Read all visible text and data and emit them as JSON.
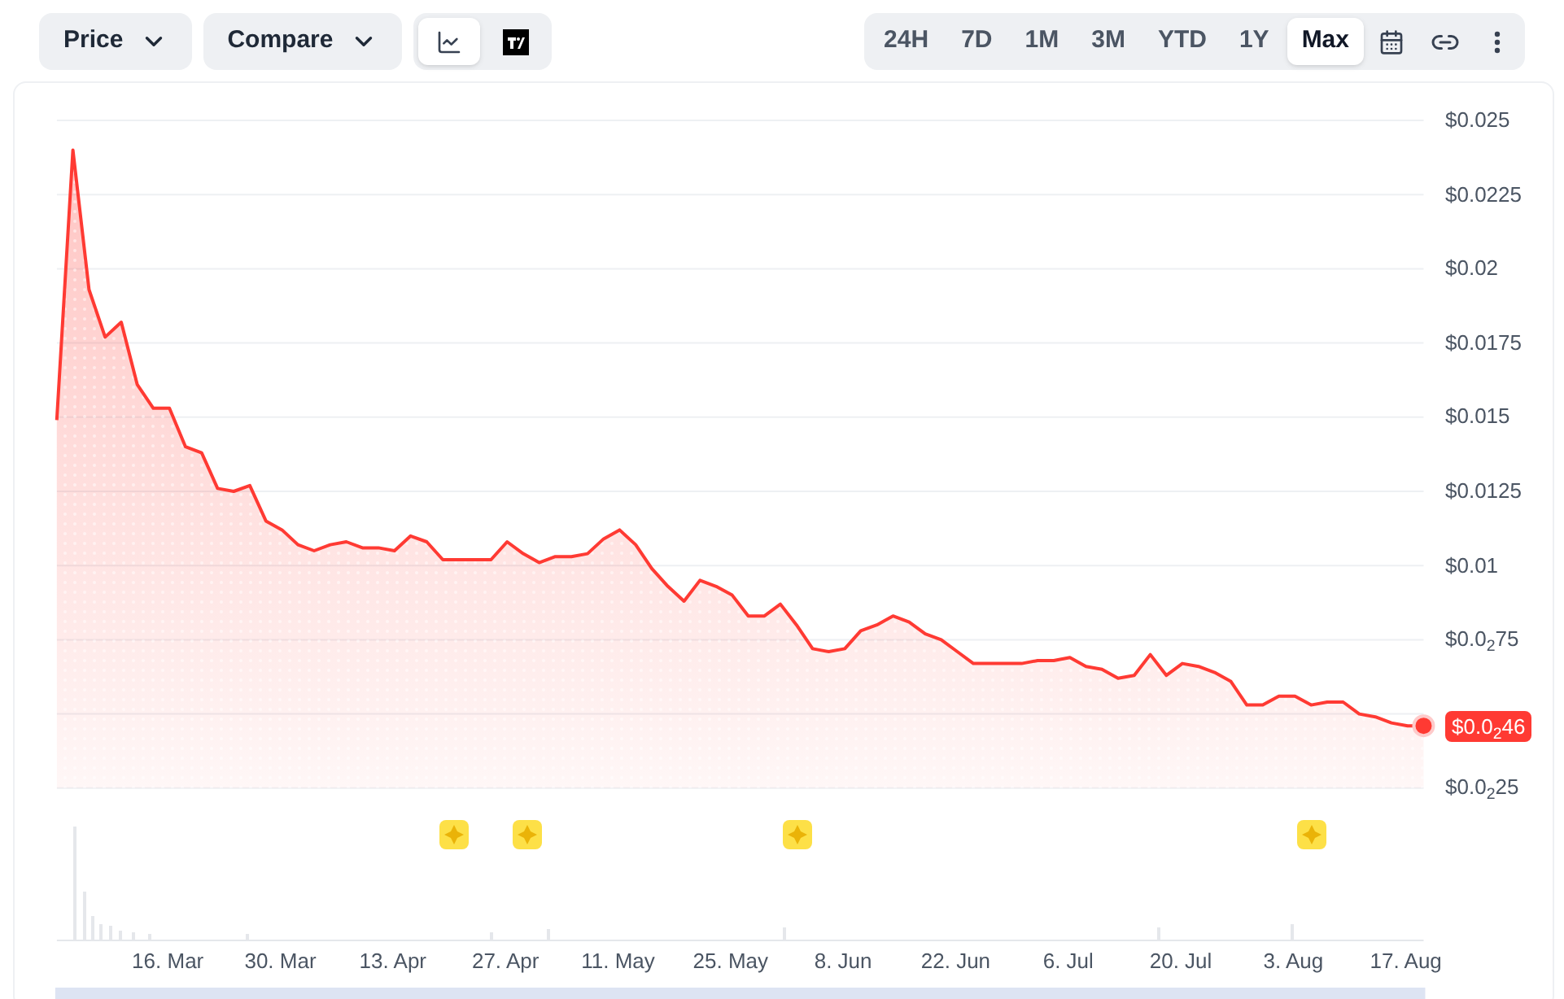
{
  "toolbar": {
    "dropdowns": [
      {
        "label": "Price"
      },
      {
        "label": "Compare"
      }
    ],
    "chart_types": [
      {
        "kind": "line",
        "selected": true
      },
      {
        "kind": "tradingview",
        "selected": false
      }
    ],
    "ranges": [
      {
        "label": "24H",
        "selected": false
      },
      {
        "label": "7D",
        "selected": false
      },
      {
        "label": "1M",
        "selected": false
      },
      {
        "label": "3M",
        "selected": false
      },
      {
        "label": "YTD",
        "selected": false
      },
      {
        "label": "1Y",
        "selected": false
      },
      {
        "label": "Max",
        "selected": true
      }
    ]
  },
  "chart": {
    "chart_data": {
      "type": "area",
      "grid": true,
      "ylim": [
        0.0025,
        0.025
      ],
      "categories": [
        null,
        null,
        null,
        null,
        null,
        null,
        null,
        "16. Mar",
        null,
        null,
        null,
        null,
        null,
        null,
        "30. Mar",
        null,
        null,
        null,
        null,
        null,
        null,
        "13. Apr",
        null,
        null,
        null,
        null,
        null,
        null,
        "27. Apr",
        null,
        null,
        null,
        null,
        null,
        null,
        "11. May",
        null,
        null,
        null,
        null,
        null,
        null,
        "25. May",
        null,
        null,
        null,
        null,
        null,
        null,
        "8. Jun",
        null,
        null,
        null,
        null,
        null,
        null,
        "22. Jun",
        null,
        null,
        null,
        null,
        null,
        null,
        "6. Jul",
        null,
        null,
        null,
        null,
        null,
        null,
        "20. Jul",
        null,
        null,
        null,
        null,
        null,
        null,
        "3. Aug",
        null,
        null,
        null,
        null,
        null,
        null,
        "17. Aug",
        null
      ],
      "yticks": [
        {
          "value": 0.025,
          "label": "$0.025"
        },
        {
          "value": 0.0225,
          "label": "$0.0225"
        },
        {
          "value": 0.02,
          "label": "$0.02"
        },
        {
          "value": 0.0175,
          "label": "$0.0175"
        },
        {
          "value": 0.015,
          "label": "$0.015"
        },
        {
          "value": 0.0125,
          "label": "$0.0125"
        },
        {
          "value": 0.01,
          "label": "$0.01"
        },
        {
          "value": 0.0075,
          "label": "$0.0$_{2}$75"
        },
        {
          "value": 0.0025,
          "label": "$0.0$_{2}$25"
        }
      ],
      "series": [
        {
          "color": "#ff3a33",
          "values": [
            0.0149,
            0.024,
            0.0193,
            0.0177,
            0.0182,
            0.0161,
            0.0153,
            0.0153,
            0.014,
            0.0138,
            0.0126,
            0.0125,
            0.0127,
            0.0115,
            0.0112,
            0.0107,
            0.0105,
            0.0107,
            0.0108,
            0.0106,
            0.0106,
            0.0105,
            0.011,
            0.0108,
            0.0102,
            0.0102,
            0.0102,
            0.0102,
            0.0108,
            0.0104,
            0.0101,
            0.0103,
            0.0103,
            0.0104,
            0.0109,
            0.0112,
            0.0107,
            0.0099,
            0.0093,
            0.0088,
            0.0095,
            0.0093,
            0.009,
            0.0083,
            0.0083,
            0.0087,
            0.008,
            0.0072,
            0.0071,
            0.0072,
            0.0078,
            0.008,
            0.0083,
            0.0081,
            0.0077,
            0.0075,
            0.0071,
            0.0067,
            0.0067,
            0.0067,
            0.0067,
            0.0068,
            0.0068,
            0.0069,
            0.0066,
            0.0065,
            0.0062,
            0.0063,
            0.007,
            0.0063,
            0.0067,
            0.0066,
            0.0064,
            0.0061,
            0.0053,
            0.0053,
            0.0056,
            0.0056,
            0.0053,
            0.0054,
            0.0054,
            0.005,
            0.0049,
            0.0047,
            0.0046,
            0.0046
          ]
        }
      ],
      "annotations": [
        "$0.0$_{2}$46"
      ]
    }
  }
}
